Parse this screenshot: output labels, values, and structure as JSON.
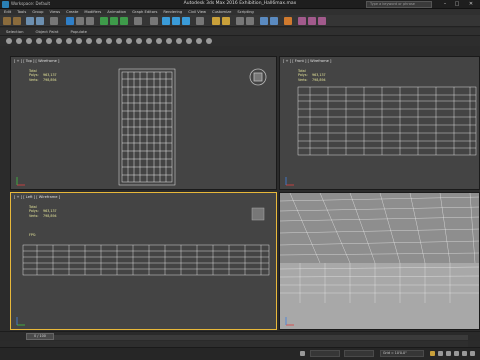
{
  "window": {
    "title": "Autodesk 3ds Max 2016   Exhibition_Hall6max.max",
    "workspace": "Workspace: Default",
    "search_placeholder": "Type a keyword or phrase",
    "min": "–",
    "max": "□",
    "close": "✕"
  },
  "menu": [
    "Edit",
    "Tools",
    "Group",
    "Views",
    "Create",
    "Modifiers",
    "Animation",
    "Graph Editors",
    "Rendering",
    "Civil View",
    "Customize",
    "Scripting"
  ],
  "ribbon": {
    "tabs": [
      "Selection",
      "Object Paint",
      "Populate"
    ]
  },
  "viewports": {
    "top": {
      "label": "[ + ] [ Top ] [ Wireframe ]"
    },
    "front": {
      "label": "[ + ] [ Front ] [ Wireframe ]"
    },
    "left": {
      "label": "[ + ] [ Left ] [ Wireframe ]"
    },
    "perspective": {
      "label": ""
    }
  },
  "stats": {
    "header": "Total",
    "polys_label": "Polys:",
    "polys": "963,137",
    "verts_label": "Verts:",
    "verts": "798,894",
    "fps_label": "FPS:"
  },
  "timeline": {
    "frame": "0 / 100"
  },
  "status": {
    "prompt": "",
    "coord_x": "",
    "coord_y": "",
    "grid": "Grid = 10'0.0\""
  },
  "colors": {
    "active_viewport": "#e8b83a",
    "stats_text": "#e5e59a",
    "wire": "#e8e8e8",
    "viewport_bg": "#444444"
  }
}
